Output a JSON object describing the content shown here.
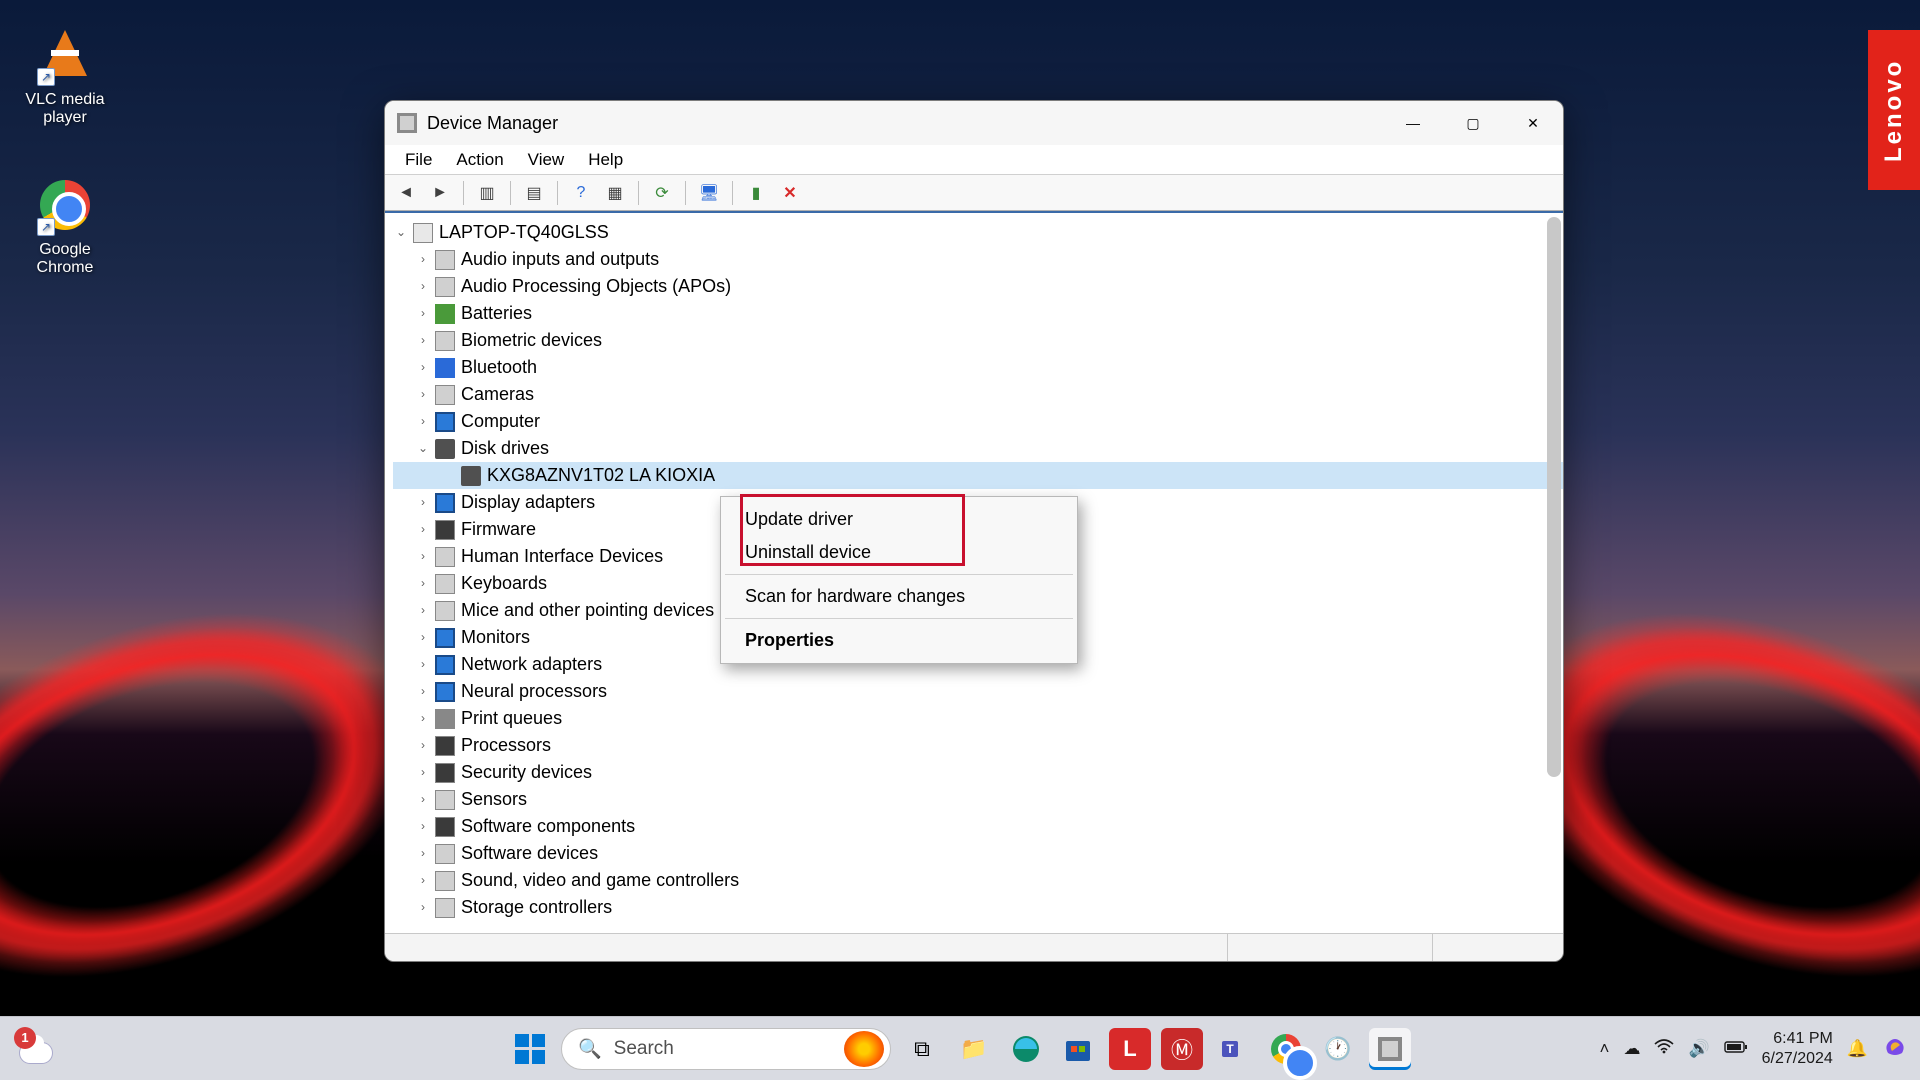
{
  "desktopIcons": [
    {
      "id": "vlc",
      "label": "VLC media player"
    },
    {
      "id": "chrome",
      "label": "Google Chrome"
    }
  ],
  "brandTab": "Lenovo",
  "window": {
    "title": "Device Manager",
    "menus": [
      "File",
      "Action",
      "View",
      "Help"
    ],
    "root": "LAPTOP-TQ40GLSS",
    "categories": [
      "Audio inputs and outputs",
      "Audio Processing Objects (APOs)",
      "Batteries",
      "Biometric devices",
      "Bluetooth",
      "Cameras",
      "Computer",
      "Disk drives",
      "Display adapters",
      "Firmware",
      "Human Interface Devices",
      "Keyboards",
      "Mice and other pointing devices",
      "Monitors",
      "Network adapters",
      "Neural processors",
      "Print queues",
      "Processors",
      "Security devices",
      "Sensors",
      "Software components",
      "Software devices",
      "Sound, video and game controllers",
      "Storage controllers"
    ],
    "selectedDevice": "KXG8AZNV1T02 LA KIOXIA",
    "contextMenu": {
      "items": [
        "Update driver",
        "Uninstall device"
      ],
      "scan": "Scan for hardware changes",
      "properties": "Properties"
    }
  },
  "taskbar": {
    "weatherBadge": "1",
    "searchPlaceholder": "Search",
    "clock": {
      "time": "6:41 PM",
      "date": "6/27/2024"
    }
  }
}
